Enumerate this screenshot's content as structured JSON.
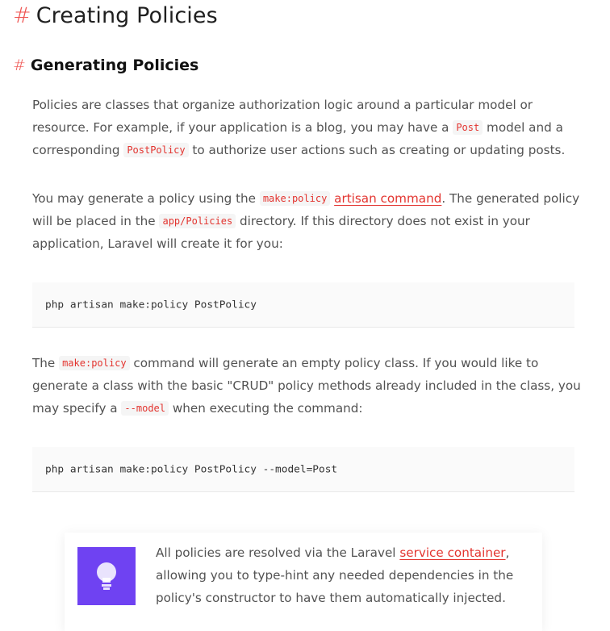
{
  "headings": {
    "hash_symbol": "#",
    "h1": "Creating Policies",
    "h2": "Generating Policies"
  },
  "p1": {
    "t1": "Policies are classes that organize authorization logic around a particular model or resource. For example, if your application is a blog, you may have a ",
    "code1": "Post",
    "t2": " model and a corresponding ",
    "code2": "PostPolicy",
    "t3": " to authorize user actions such as creating or updating posts."
  },
  "p2": {
    "t1": "You may generate a policy using the ",
    "code1": "make:policy",
    "t2": " ",
    "link": "artisan command",
    "t3": ". The generated policy will be placed in the ",
    "code2": "app/Policies",
    "t4": " directory. If this directory does not exist in your application, Laravel will create it for you:"
  },
  "code_block_1": "php artisan make:policy PostPolicy",
  "p3": {
    "t1": "The ",
    "code1": "make:policy",
    "t2": " command will generate an empty policy class. If you would like to generate a class with the basic \"CRUD\" policy methods already included in the class, you may specify a ",
    "code2": "--model",
    "t3": " when executing the command:"
  },
  "code_block_2": "php artisan make:policy PostPolicy --model=Post",
  "callout": {
    "icon": "lightbulb-icon",
    "t1": "All policies are resolved via the Laravel ",
    "link": "service container",
    "t2": ", allowing you to type-hint any needed dependencies in the policy's constructor to have them automatically injected."
  },
  "colors": {
    "accent": "#ef5350",
    "code_text": "#e3342f",
    "callout_icon_bg": "#6f42f2",
    "body_text": "#525252"
  }
}
